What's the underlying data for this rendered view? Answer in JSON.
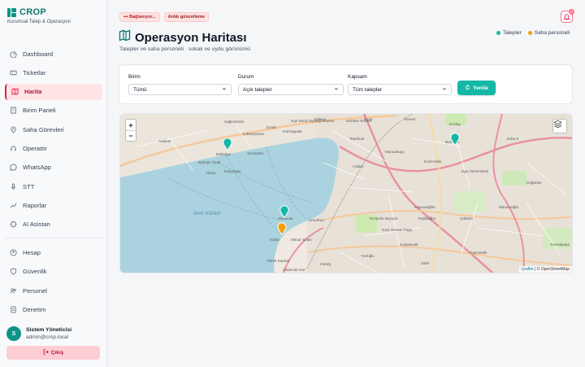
{
  "brand": {
    "name": "CROP",
    "subtitle": "Kurumsal Talep & Operasyon"
  },
  "nav": {
    "items": [
      {
        "label": "Dashboard",
        "icon": "dashboard-icon"
      },
      {
        "label": "Ticketlar",
        "icon": "ticket-icon"
      },
      {
        "label": "Harita",
        "icon": "map-icon",
        "active": true
      },
      {
        "label": "Birim Paneli",
        "icon": "building-icon"
      },
      {
        "label": "Saha Görevleri",
        "icon": "location-pin-icon"
      },
      {
        "label": "Operatör",
        "icon": "headset-icon"
      },
      {
        "label": "WhatsApp",
        "icon": "whatsapp-icon"
      },
      {
        "label": "STT",
        "icon": "microphone-icon"
      },
      {
        "label": "Raporlar",
        "icon": "report-icon"
      },
      {
        "label": "AI Asistan",
        "icon": "ai-icon"
      }
    ],
    "account_items": [
      {
        "label": "Hesap",
        "icon": "user-icon"
      },
      {
        "label": "Güvenlik",
        "icon": "shield-icon"
      },
      {
        "label": "Personel",
        "icon": "users-icon"
      },
      {
        "label": "Denetim",
        "icon": "audit-icon"
      }
    ]
  },
  "user": {
    "initial": "S",
    "name": "Sistem Yöneticisi",
    "email": "admin@crop.local"
  },
  "logout_label": "Çıkış",
  "status_chips": {
    "connection": "Bağlanıyor...",
    "live": "Anlık güncelleme"
  },
  "notifications": {
    "count": "0"
  },
  "page": {
    "title": "Operasyon Haritası",
    "subtitle": "Talepler ve saha personeli · sokak ve uydu görünümü"
  },
  "legend": [
    {
      "label": "Talepler",
      "color": "#14b8a6"
    },
    {
      "label": "Saha personeli",
      "color": "#f59e0b"
    }
  ],
  "filters": {
    "unit": {
      "label": "Birim",
      "value": "Tümü"
    },
    "status": {
      "label": "Durum",
      "value": "Açık talepler"
    },
    "scope": {
      "label": "Kapsam",
      "value": "Tüm talepler"
    },
    "refresh_label": "Yenile"
  },
  "map": {
    "zoom_in": "+",
    "zoom_out": "−",
    "attribution_leaflet": "Leaflet",
    "attribution_osm": "| © OpenStreetMap",
    "place_labels": [
      "Sütlüce",
      "Eyüp",
      "Gümüşpala",
      "Emek",
      "Sağmalcılar",
      "Ege Deniz Biyoloji Müzesi",
      "Muhittin Erener",
      "Kemer",
      "Kızılay",
      "Atakent",
      "Çobançeşme",
      "Bahariye",
      "Yenisahre",
      "Tepekule",
      "Manavkuyu",
      "Bornova",
      "Evka 3",
      "Bahriye Üçok",
      "Karşıyaka",
      "Aksoy",
      "Adalet",
      "Kazımdirik",
      "Ege Üniversitesi",
      "Doğanlar",
      "Alsancak",
      "Mansuroğlu",
      "Karacaoğlan",
      "Işıkkent",
      "Yeşilbağlar",
      "Umurbey",
      "Yenişehir Beyazıt",
      "Gazi Osman Paşa",
      "Koşukavak",
      "Kültür",
      "Mimar Sinan",
      "Tilmet Kaptan",
      "Güney",
      "Alsancak Gar",
      "Zafer",
      "Egemenlik",
      "Yurtoğlu",
      "Kemalpaşa"
    ],
    "sea_labels": [
      "İzmir Körfezi"
    ],
    "markers": [
      {
        "type": "talep",
        "color": "#14b8a6"
      },
      {
        "type": "talep",
        "color": "#14b8a6"
      },
      {
        "type": "talep",
        "color": "#14b8a6"
      },
      {
        "type": "personel",
        "color": "#f59e0b"
      }
    ]
  }
}
